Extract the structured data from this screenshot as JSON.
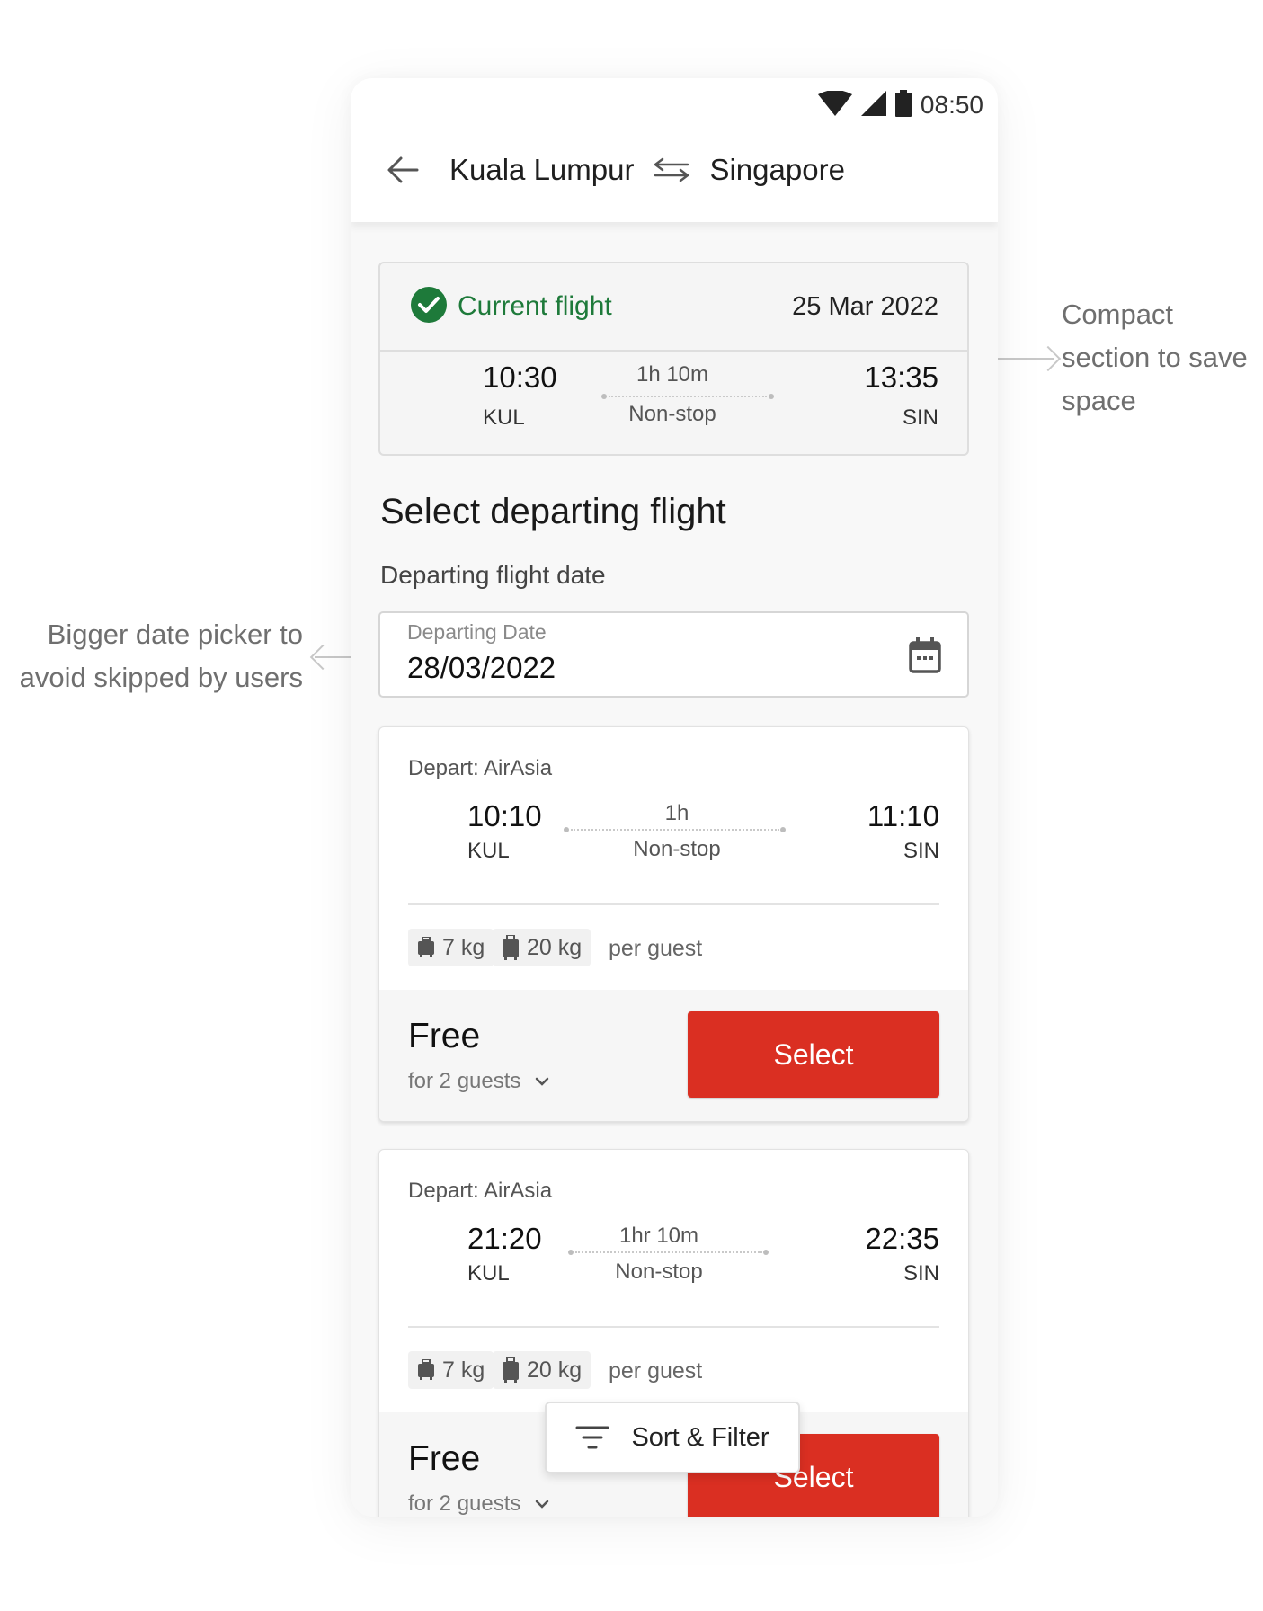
{
  "annotations": {
    "right": [
      "Compact",
      "section to save",
      "space"
    ],
    "left": [
      "Bigger date picker to",
      "avoid skipped by users"
    ]
  },
  "status_bar": {
    "time": "08:50"
  },
  "header": {
    "origin": "Kuala Lumpur",
    "destination": "Singapore"
  },
  "current_flight": {
    "label": "Current flight",
    "date": "25 Mar 2022",
    "depart_time": "10:30",
    "depart_code": "KUL",
    "duration": "1h 10m",
    "stops": "Non-stop",
    "arrive_time": "13:35",
    "arrive_code": "SIN"
  },
  "section": {
    "title": "Select departing flight",
    "subtitle": "Departing flight date"
  },
  "date_field": {
    "label": "Departing Date",
    "value": "28/03/2022"
  },
  "flights": [
    {
      "airline": "Depart: AirAsia",
      "depart_time": "10:10",
      "depart_code": "KUL",
      "duration": "1h",
      "stops": "Non-stop",
      "arrive_time": "11:10",
      "arrive_code": "SIN",
      "cabin_bag": "7 kg",
      "checked_bag": "20 kg",
      "per_guest": "per guest",
      "price": "Free",
      "guests": "for 2 guests",
      "select_label": "Select"
    },
    {
      "airline": "Depart: AirAsia",
      "depart_time": "21:20",
      "depart_code": "KUL",
      "duration": "1hr 10m",
      "stops": "Non-stop",
      "arrive_time": "22:35",
      "arrive_code": "SIN",
      "cabin_bag": "7 kg",
      "checked_bag": "20 kg",
      "per_guest": "per guest",
      "price": "Free",
      "guests": "for 2 guests",
      "select_label": "Select"
    }
  ],
  "sort_filter": {
    "label": "Sort & Filter"
  },
  "colors": {
    "accent_red": "#da2f22",
    "success_green": "#1e7a3a"
  },
  "icons": [
    "wifi-icon",
    "signal-icon",
    "battery-icon",
    "back-arrow-icon",
    "swap-arrows-icon",
    "check-circle-icon",
    "calendar-icon",
    "cabin-bag-icon",
    "luggage-icon",
    "chevron-down-icon",
    "filter-icon"
  ]
}
